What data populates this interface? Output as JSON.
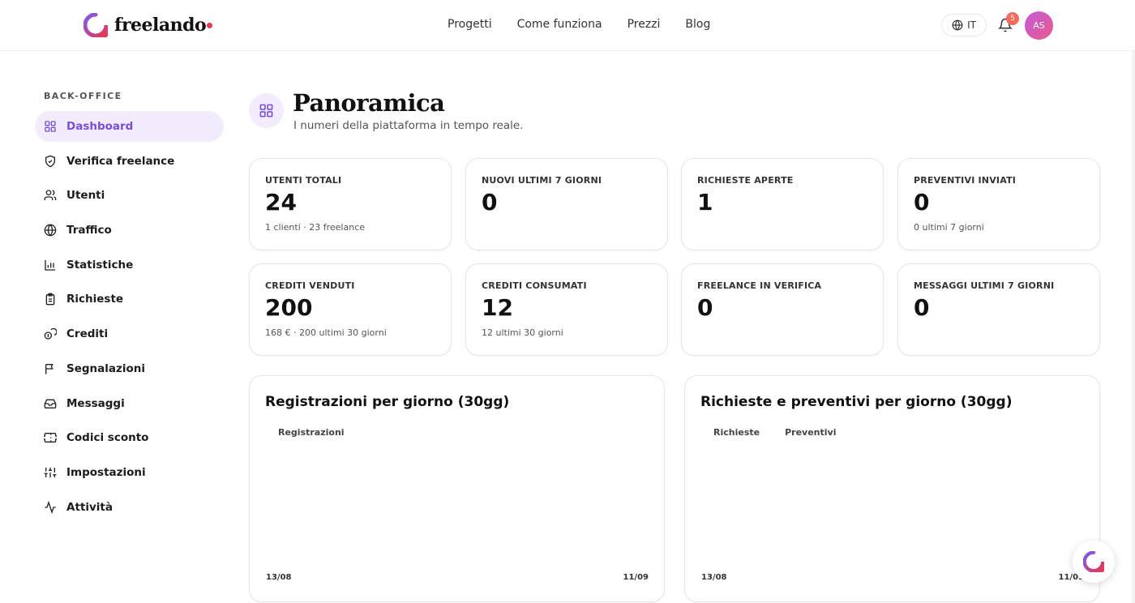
{
  "brand": {
    "name": "freelando",
    "accent": "#7a4fd6",
    "logo_gradient": [
      "#7b5cf0",
      "#e8384f"
    ]
  },
  "nav": {
    "items": [
      "Progetti",
      "Come funziona",
      "Prezzi",
      "Blog"
    ]
  },
  "header_right": {
    "lang": "IT",
    "notifications": "5",
    "avatar_initials": "AS"
  },
  "sidebar": {
    "section": "BACK-OFFICE",
    "items": [
      {
        "label": "Dashboard",
        "icon": "grid-icon",
        "active": true
      },
      {
        "label": "Verifica freelance",
        "icon": "shield-icon"
      },
      {
        "label": "Utenti",
        "icon": "users-icon"
      },
      {
        "label": "Traffico",
        "icon": "globe-icon"
      },
      {
        "label": "Statistiche",
        "icon": "bar-chart-icon"
      },
      {
        "label": "Richieste",
        "icon": "clipboard-icon"
      },
      {
        "label": "Crediti",
        "icon": "coins-icon"
      },
      {
        "label": "Segnalazioni",
        "icon": "flag-icon"
      },
      {
        "label": "Messaggi",
        "icon": "inbox-icon"
      },
      {
        "label": "Codici sconto",
        "icon": "ticket-icon"
      },
      {
        "label": "Impostazioni",
        "icon": "sliders-icon"
      },
      {
        "label": "Attività",
        "icon": "activity-icon"
      }
    ]
  },
  "page": {
    "title": "Panoramica",
    "subtitle": "I numeri della piattaforma in tempo reale."
  },
  "stats": [
    {
      "label": "UTENTI TOTALI",
      "value": "24",
      "sub": "1 clienti · 23 freelance"
    },
    {
      "label": "NUOVI ULTIMI 7 GIORNI",
      "value": "0",
      "sub": ""
    },
    {
      "label": "RICHIESTE APERTE",
      "value": "1",
      "sub": ""
    },
    {
      "label": "PREVENTIVI INVIATI",
      "value": "0",
      "sub": "0 ultimi 7 giorni"
    },
    {
      "label": "CREDITI VENDUTI",
      "value": "200",
      "sub": "168 € · 200 ultimi 30 giorni"
    },
    {
      "label": "CREDITI CONSUMATI",
      "value": "12",
      "sub": "12 ultimi 30 giorni"
    },
    {
      "label": "FREELANCE IN VERIFICA",
      "value": "0",
      "sub": ""
    },
    {
      "label": "MESSAGGI ULTIMI 7 GIORNI",
      "value": "0",
      "sub": ""
    }
  ],
  "charts": {
    "registrations": {
      "title": "Registrazioni per giorno (30gg)",
      "legend": [
        "Registrazioni"
      ],
      "x_start": "13/08",
      "x_end": "11/09"
    },
    "requests": {
      "title": "Richieste e preventivi per giorno (30gg)",
      "legend": [
        "Richieste",
        "Preventivi"
      ],
      "x_start": "13/08",
      "x_end": "11/09"
    }
  }
}
